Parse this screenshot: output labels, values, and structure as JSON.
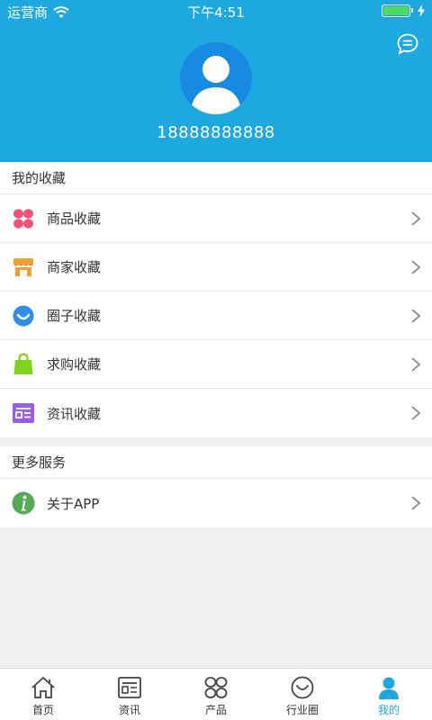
{
  "status_bar": {
    "carrier": "运营商",
    "time": "下午4:51"
  },
  "profile": {
    "phone": "18888888888"
  },
  "favorites": {
    "title": "我的收藏",
    "items": [
      {
        "label": "商品收藏",
        "icon": "product-grid-icon",
        "color": "#f0507a"
      },
      {
        "label": "商家收藏",
        "icon": "store-icon",
        "color": "#f0a030"
      },
      {
        "label": "圈子收藏",
        "icon": "circle-smile-icon",
        "color": "#2f8fe8"
      },
      {
        "label": "求购收藏",
        "icon": "shopping-bag-icon",
        "color": "#7ed321"
      },
      {
        "label": "资讯收藏",
        "icon": "news-icon",
        "color": "#9a5de8"
      }
    ]
  },
  "services": {
    "title": "更多服务",
    "items": [
      {
        "label": "关于APP",
        "icon": "info-icon",
        "color": "#55aa55"
      }
    ]
  },
  "tabbar": {
    "active": "我的",
    "active_color": "#1ea8e0",
    "items": [
      {
        "label": "首页",
        "icon": "home-icon"
      },
      {
        "label": "资讯",
        "icon": "news-icon"
      },
      {
        "label": "产品",
        "icon": "product-icon"
      },
      {
        "label": "行业圈",
        "icon": "circle-icon"
      },
      {
        "label": "我的",
        "icon": "user-icon"
      }
    ]
  },
  "colors": {
    "header": "#1ea8e0",
    "avatar_bg": "#1689e0",
    "page_bg": "#f0f0f0"
  }
}
